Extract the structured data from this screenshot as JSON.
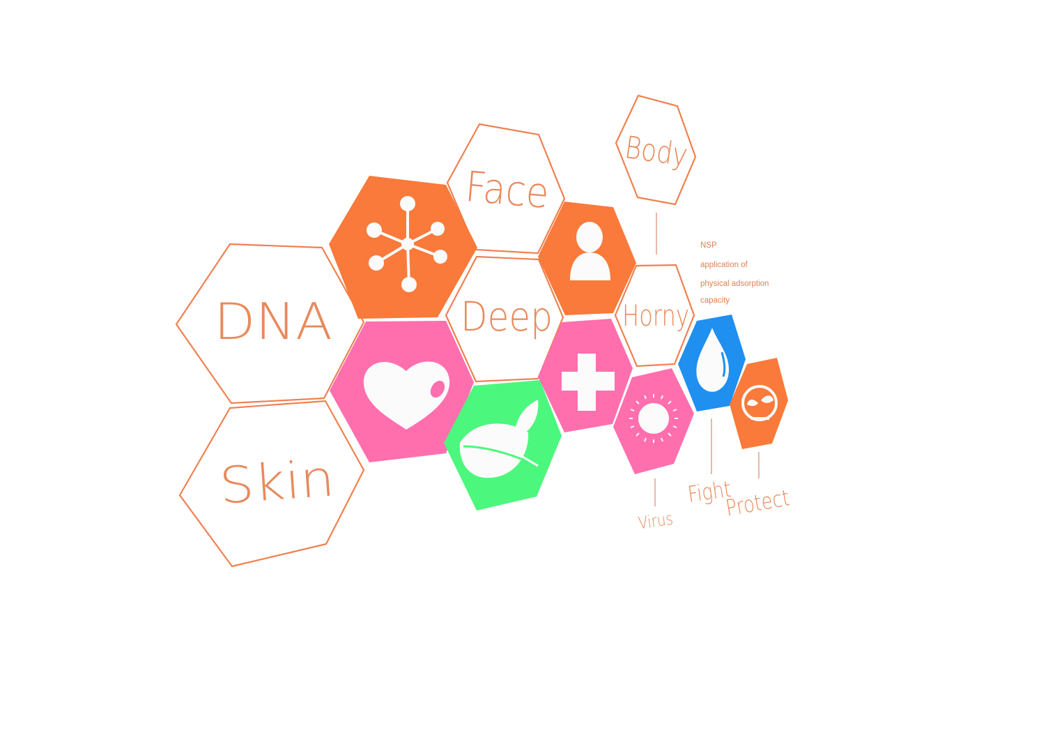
{
  "labels": {
    "dna": "DNA",
    "skin": "Skin",
    "face": "Face",
    "deep": "Deep",
    "body": "Body",
    "horny": "Horny",
    "virus": "Virus",
    "fight": "Fight",
    "protect": "Protect"
  },
  "nsp_note": {
    "line1": "NSP",
    "line2": "application of",
    "line3": "physical adsorption",
    "line4": "capacity"
  },
  "icons": {
    "molecule": "molecule-icon",
    "person": "person-icon",
    "heart": "heart-icon",
    "leaf": "leaf-icon",
    "cross": "plus-cross-icon",
    "virus": "virus-icon",
    "drop": "water-drop-icon",
    "sprout": "sprout-icon"
  },
  "colors": {
    "orange": "#f97a3a",
    "pink": "#ff6fae",
    "green": "#4cf77d",
    "blue": "#1f8ff0",
    "outline": "#f08050",
    "text": "#e88a5c"
  }
}
